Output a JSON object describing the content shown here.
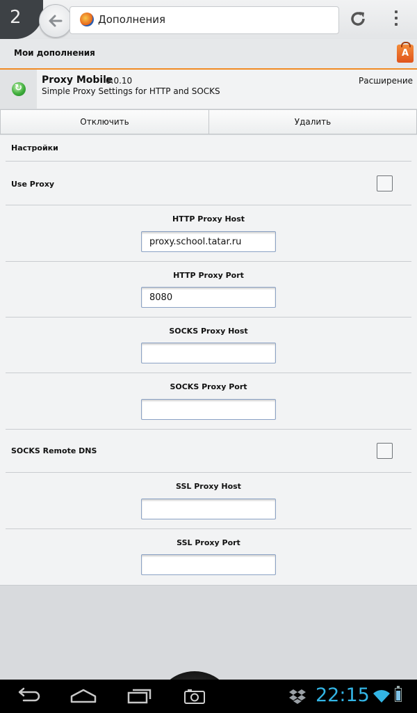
{
  "toolbar": {
    "tabs_count": "2",
    "url_title": "Дополнения"
  },
  "header": {
    "title": "Мои дополнения",
    "bag_letter": "A"
  },
  "addon": {
    "name": "Proxy Mobile",
    "version": "0.0.10",
    "description": "Simple Proxy Settings for HTTP and SOCKS",
    "type": "Расширение"
  },
  "actions": {
    "disable_label": "Отключить",
    "remove_label": "Удалить"
  },
  "settings": {
    "section_title": "Настройки",
    "use_proxy": {
      "label": "Use Proxy",
      "checked": false
    },
    "http_host": {
      "label": "HTTP Proxy Host",
      "value": "proxy.school.tatar.ru"
    },
    "http_port": {
      "label": "HTTP Proxy Port",
      "value": "8080"
    },
    "socks_host": {
      "label": "SOCKS Proxy Host",
      "value": ""
    },
    "socks_port": {
      "label": "SOCKS Proxy Port",
      "value": ""
    },
    "socks_remote_dns": {
      "label": "SOCKS Remote DNS",
      "checked": false
    },
    "ssl_host": {
      "label": "SSL Proxy Host",
      "value": ""
    },
    "ssl_port": {
      "label": "SSL Proxy Port",
      "value": ""
    }
  },
  "status": {
    "clock": "22:15"
  },
  "icons": {
    "back": "back-arrow-icon",
    "reload": "reload-icon",
    "menu": "overflow-menu-icon",
    "browser": "firefox-icon",
    "marketplace": "shopping-bag-icon",
    "addon": "proxy-addon-icon",
    "nav_back": "back-icon",
    "nav_home": "home-icon",
    "nav_recents": "recent-apps-icon",
    "screenshot": "camera-icon",
    "dropbox": "dropbox-icon",
    "wifi": "wifi-icon",
    "battery": "battery-icon"
  },
  "colors": {
    "accent_orange": "#f08a24",
    "clock_blue": "#33b5e5"
  }
}
